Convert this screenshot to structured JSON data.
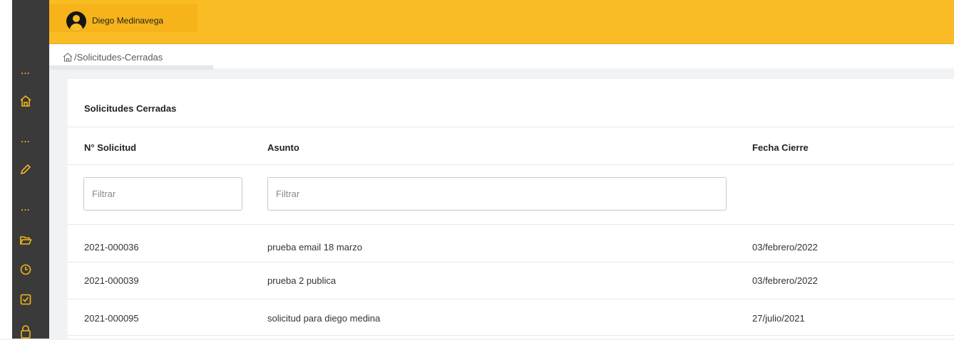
{
  "user": {
    "name": "Diego Medinavega"
  },
  "breadcrumb": {
    "path": "/Solicitudes-Cerradas"
  },
  "page": {
    "title": "Solicitudes Cerradas"
  },
  "table": {
    "columns": [
      "N° Solicitud",
      "Asunto",
      "Fecha Cierre"
    ],
    "filters": {
      "solicitud_placeholder": "Filtrar",
      "asunto_placeholder": "Filtrar"
    },
    "rows": [
      {
        "solicitud": "2021-000036",
        "asunto": "prueba email 18 marzo",
        "fecha": "03/febrero/2022"
      },
      {
        "solicitud": "2021-000039",
        "asunto": "prueba 2 publica",
        "fecha": "03/febrero/2022"
      },
      {
        "solicitud": "2021-000095",
        "asunto": "solicitud para diego medina",
        "fecha": "27/julio/2021"
      }
    ]
  },
  "sidebar": {
    "items": [
      {
        "type": "dots"
      },
      {
        "icon": "home-icon"
      },
      {
        "type": "dots"
      },
      {
        "icon": "pencil-icon"
      },
      {
        "type": "dots"
      },
      {
        "icon": "folder-open-icon"
      },
      {
        "icon": "clock-icon"
      },
      {
        "icon": "checkbox-icon"
      },
      {
        "icon": "lock-icon"
      }
    ]
  },
  "colors": {
    "accent": "#f9bc25",
    "sidebar": "#3a3a3a",
    "icon": "#f4b71a"
  }
}
